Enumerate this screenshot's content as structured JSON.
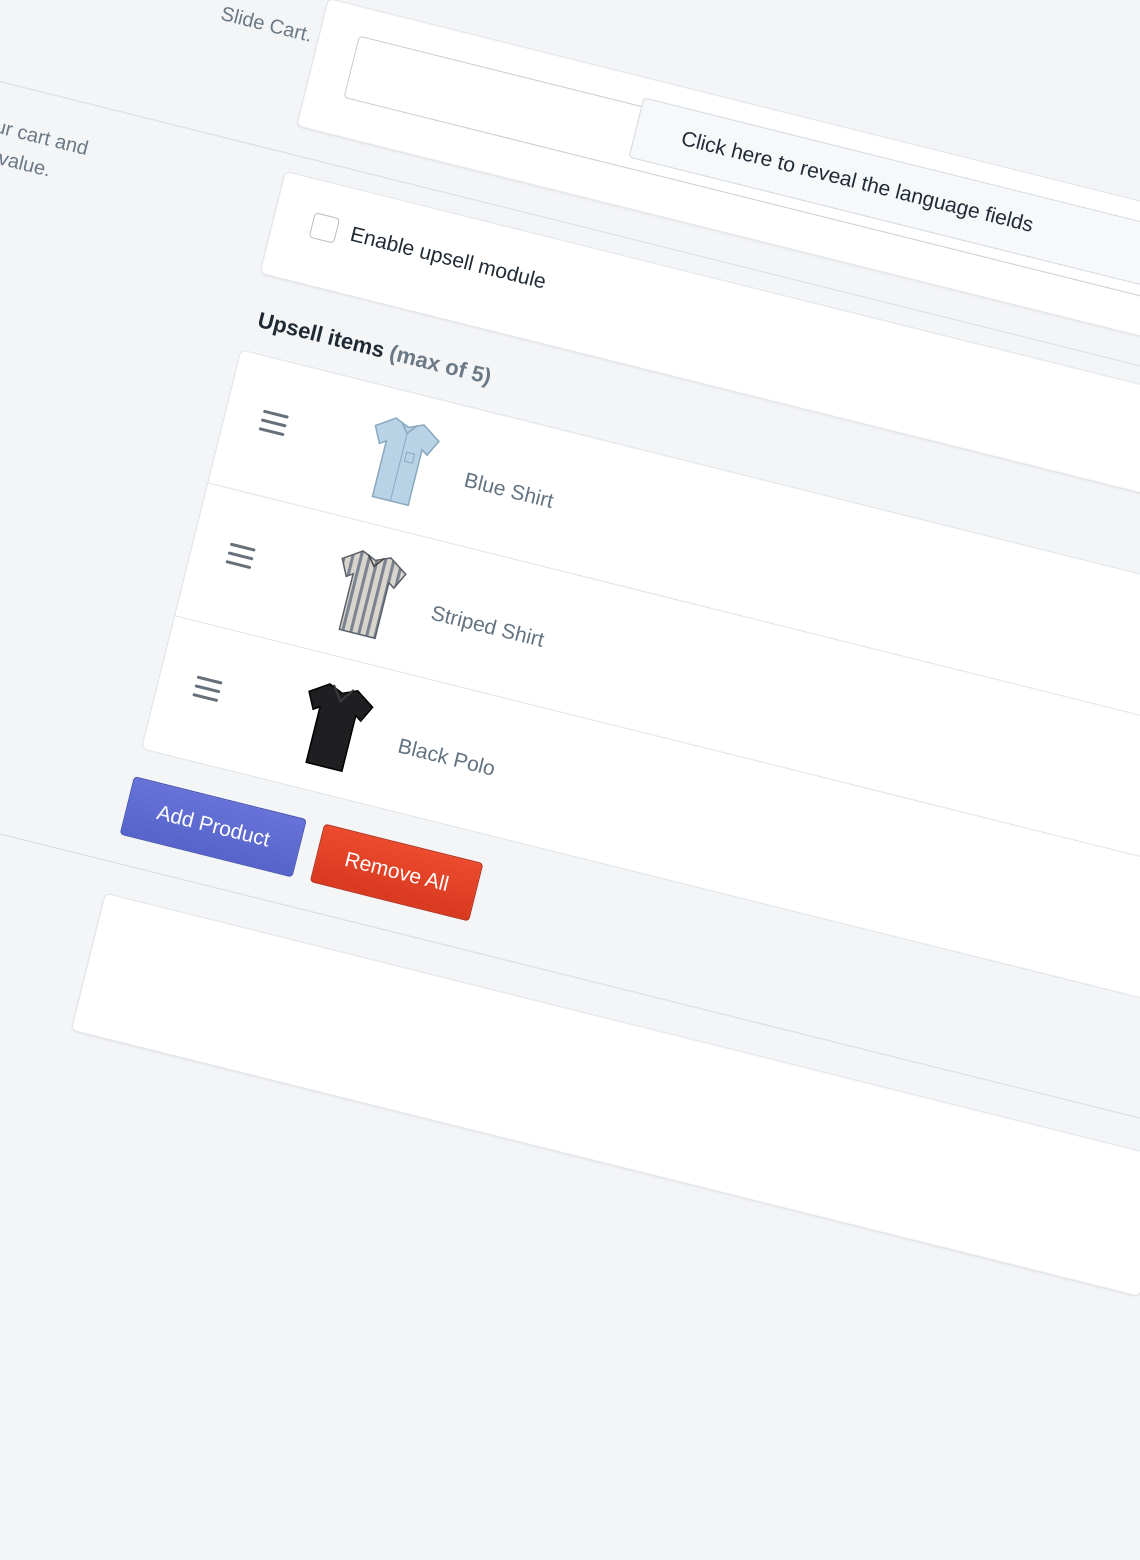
{
  "slide_cart": {
    "description_fragment": "Slide Cart."
  },
  "language": {
    "reveal_label": "Click here to reveal the language fields"
  },
  "upsell": {
    "description_line1": "y in your cart and",
    "description_line2": "e order value.",
    "enable_label": "Enable upsell module",
    "enabled": false,
    "items_title": "Upsell items",
    "items_hint": "(max of 5)",
    "items": [
      {
        "name": "Blue Shirt",
        "icon": "shirt-icon"
      },
      {
        "name": "Striped Shirt",
        "icon": "shirt-icon"
      },
      {
        "name": "Black Polo",
        "icon": "shirt-icon"
      }
    ],
    "add_label": "Add Product",
    "remove_label": "Remove All"
  },
  "colors": {
    "primary": "#5c6ac4",
    "danger": "#de3618",
    "text": "#212b36",
    "subdued": "#637381",
    "background": "#f4f5f7"
  }
}
